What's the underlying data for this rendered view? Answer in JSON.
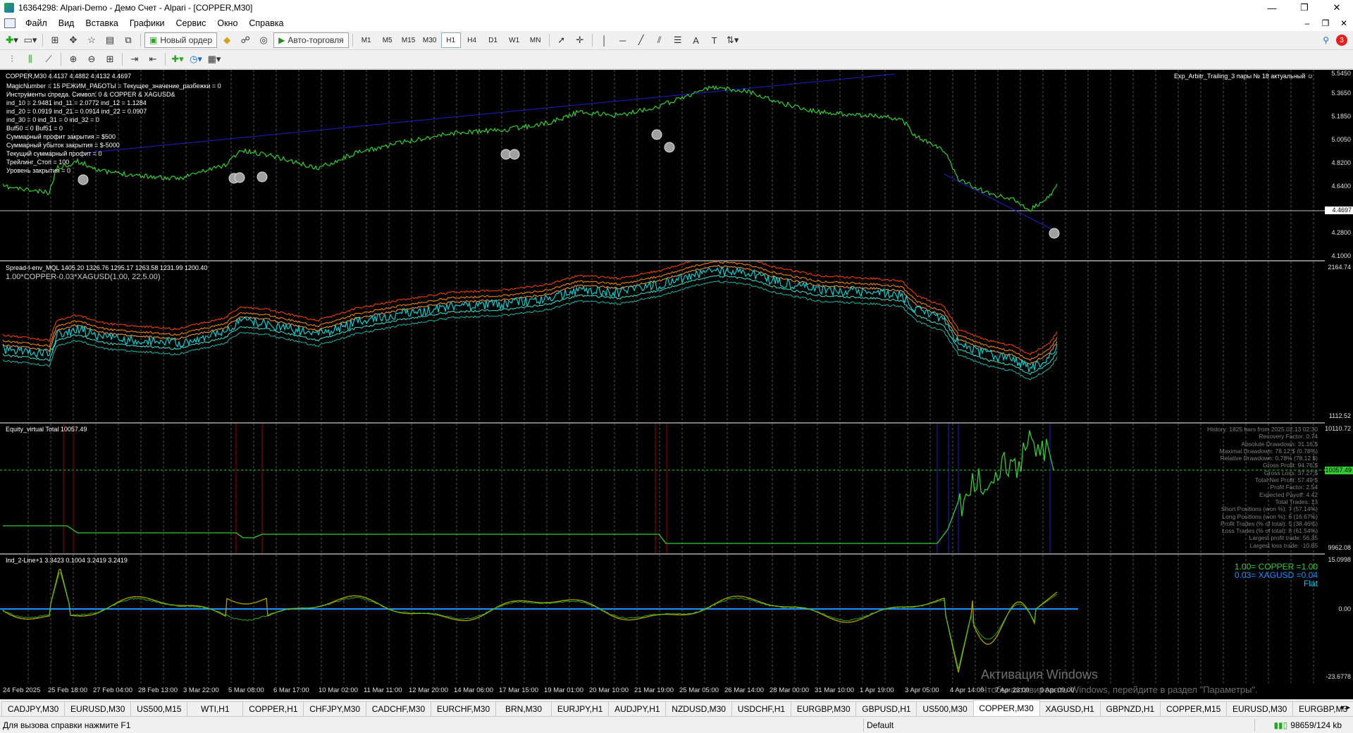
{
  "window": {
    "title": "16364298: Alpari-Demo - Демо Счет - Alpari - [COPPER,M30]",
    "minimize": "—",
    "maximize": "❐",
    "close": "✕"
  },
  "menu": {
    "items": [
      "Файл",
      "Вид",
      "Вставка",
      "Графики",
      "Сервис",
      "Окно",
      "Справка"
    ],
    "doc_min": "–",
    "doc_restore": "❐",
    "doc_close": "✕"
  },
  "toolbar": {
    "new_order": "Новый ордер",
    "auto_trading": "Авто-торговля",
    "timeframes": [
      "M1",
      "M5",
      "M15",
      "M30",
      "H1",
      "H4",
      "D1",
      "W1",
      "MN"
    ],
    "active_timeframe": "H1",
    "text_tool": "A",
    "label_tool": "T",
    "notifications": "3"
  },
  "main_chart": {
    "header": "COPPER,M30  4.4137 4.4882 4.4132 4.4697",
    "info_lines": [
      "MagicNumber = 15 РЕЖИМ_РАБОТЫ = Текущее_значение_разбежки = 0",
      "Инструменты спреда. Символ: 0 & COPPER & XAGUSD&",
      "ind_10 = 2.9481 ind_11 = 2.0772 ind_12 = 1.1284",
      "ind_20 = 0.0919 ind_21 = 0.0914 ind_22 = 0.0907",
      "ind_30 = 0 ind_31 = 0 ind_32 = 0",
      "Buf50 = 0 Buf51 = 0",
      "Суммарный профит закрытия = $500",
      "Суммарный убыток закрытия = $-5000",
      "Текущий суммарный профит = 0",
      "Трейлинг_Стоп = 100",
      "Уровень закрытия = 0"
    ],
    "expert_label": "Exp_Arbitr_Trailing_3 пары № 18 актуальный ☺",
    "scale": [
      "5.5450",
      "5.3650",
      "5.1850",
      "5.0050",
      "4.8200",
      "4.6400",
      "4.4697",
      "4.2800",
      "4.1000"
    ],
    "current_price": "4.4697"
  },
  "spread_pane": {
    "header": "Spread-I-env_MQL 1405.20 1326.76 1295.17 1263.58 1231.99 1200.40",
    "sub_header": "1.00*COPPER-0.03*XAGUSD(1.00, 22.5.00)",
    "scale_top": "2164.74",
    "scale_bottom": "1112.52"
  },
  "equity_pane": {
    "header": "Equity_virtual Total 10057.49",
    "scale_top": "10110.72",
    "scale_value": "10057.49",
    "scale_bottom": "9962.08",
    "report": [
      "History: 1825 bars from 2025.02.13 02:30",
      "Recovery Factor: 0.74",
      "Absolute Drawdown: 31.16 $",
      "Maximal Drawdown: 78.12 $ (0.78%)",
      "Relative Drawdown: 0.78% (78.12 $)",
      "",
      "Gross Profit: 94.76 $",
      "Gross Loss: 37.27 $",
      "Total Net Profit: 57.49 $",
      "Profit Factor: 2.54",
      "Expected Payoff: 4.42",
      "Total Trades: 13",
      "Short Positions (won %): 7 (57.14%)",
      "Long Positions (won %): 6 (16.67%)",
      "Profit Trades (% of total): 5 (38.46%)",
      "Loss Trades (% of total): 8 (61.54%)",
      "Largest profit trade: 56.35",
      "Largest loss trade: -10.85"
    ]
  },
  "osc_pane": {
    "header": "Ind_2-Line+1 3.3423 0.1004 3.2419 3.2419",
    "legend_copper": "1.00= COPPER =1.00",
    "legend_xag": "0.03= XAGUSD =0.04",
    "legend_flat": "Flat",
    "scale_top": "15.0998",
    "scale_mid": "0.00",
    "scale_bottom": "-23.6778"
  },
  "time_axis": [
    "24 Feb 2025",
    "25 Feb 18:00",
    "27 Feb 04:00",
    "28 Feb 13:00",
    "3 Mar 22:00",
    "5 Mar 08:00",
    "6 Mar 17:00",
    "10 Mar 02:00",
    "11 Mar 11:00",
    "12 Mar 20:00",
    "14 Mar 06:00",
    "17 Mar 15:00",
    "19 Mar 01:00",
    "20 Mar 10:00",
    "21 Mar 19:00",
    "25 Mar 05:00",
    "26 Mar 14:00",
    "28 Mar 00:00",
    "31 Mar 10:00",
    "1 Apr 19:00",
    "3 Apr 05:00",
    "4 Apr 14:00",
    "7 Apr 23:00",
    "9 Apr 09:00"
  ],
  "watermark": {
    "line1": "Активация Windows",
    "line2": "Чтобы активировать Windows, перейдите в раздел \"Параметры\"."
  },
  "tabs": [
    "CADJPY,M30",
    "EURUSD,M30",
    "US500,M15",
    "WTI,H1",
    "COPPER,H1",
    "CHFJPY,M30",
    "CADCHF,M30",
    "EURCHF,M30",
    "BRN,M30",
    "EURJPY,H1",
    "AUDJPY,H1",
    "NZDUSD,M30",
    "USDCHF,H1",
    "EURGBP,M30",
    "GBPUSD,H1",
    "US500,M30",
    "COPPER,M30",
    "XAGUSD,H1",
    "GBPNZD,H1",
    "COPPER,M15",
    "EURUSD,M30",
    "EURGBP,M3"
  ],
  "active_tab": "COPPER,M30",
  "status": {
    "help": "Для вызова справки нажмите F1",
    "profile": "Default",
    "traffic": "98659/124 kb"
  },
  "colors": {
    "price_line": "#32cd32",
    "spread_line": "#00d0d0",
    "envelope_upper": "#ff8c00",
    "trend_line": "#2020c0",
    "osc_line": "#b0a000",
    "zero_line": "#1e90ff"
  }
}
